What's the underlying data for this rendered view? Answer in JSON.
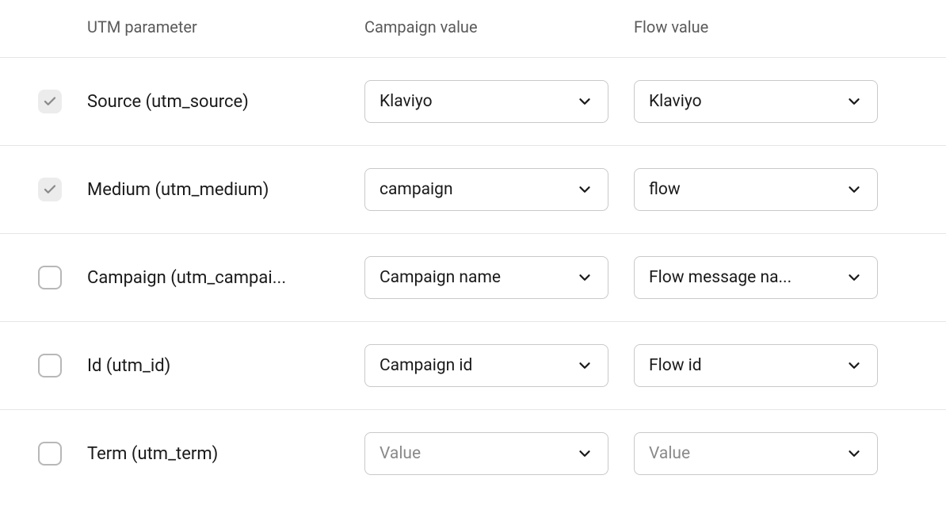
{
  "headers": {
    "param": "UTM parameter",
    "campaign": "Campaign value",
    "flow": "Flow value"
  },
  "rows": [
    {
      "checked": true,
      "disabled": true,
      "param": "Source (utm_source)",
      "campaign": "Klaviyo",
      "campaign_placeholder": false,
      "flow": "Klaviyo",
      "flow_placeholder": false
    },
    {
      "checked": true,
      "disabled": true,
      "param": "Medium (utm_medium)",
      "campaign": "campaign",
      "campaign_placeholder": false,
      "flow": "flow",
      "flow_placeholder": false
    },
    {
      "checked": false,
      "disabled": false,
      "param": "Campaign (utm_campai...",
      "campaign": "Campaign name",
      "campaign_placeholder": false,
      "flow": "Flow message na...",
      "flow_placeholder": false
    },
    {
      "checked": false,
      "disabled": false,
      "param": "Id (utm_id)",
      "campaign": "Campaign id",
      "campaign_placeholder": false,
      "flow": "Flow id",
      "flow_placeholder": false
    },
    {
      "checked": false,
      "disabled": false,
      "param": "Term (utm_term)",
      "campaign": "Value",
      "campaign_placeholder": true,
      "flow": "Value",
      "flow_placeholder": true
    }
  ]
}
